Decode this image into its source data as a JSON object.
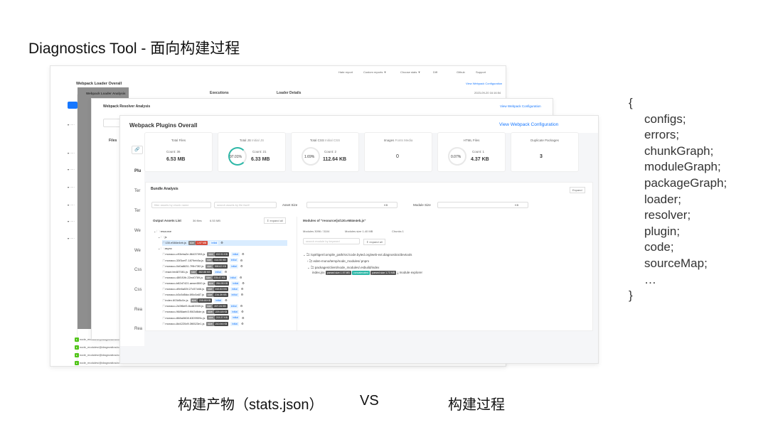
{
  "title": "Diagnostics Tool - 面向构建过程",
  "captions": {
    "left": "构建产物（stats.json）",
    "vs": "VS",
    "right": "构建过程"
  },
  "code_list": {
    "open": "{",
    "items": [
      "configs;",
      "errors;",
      "chunkGraph;",
      "moduleGraph;",
      "packageGraph;",
      "loader;",
      "resolver;",
      "plugin;",
      "code;",
      "sourceMap;",
      "…"
    ],
    "close": "}"
  },
  "top_nav": [
    "Hate report",
    "Custom reports ▼",
    "Choose stats ▼",
    "Diff",
    "Github",
    "Support"
  ],
  "loader_window": {
    "title": "Webpack Loader Overall",
    "link": "View Webpack Configuration",
    "sub_title": "Webpack Loader Analysis",
    "col1": "Executions",
    "col2": "Loader Details",
    "time": "2023-09-20 16:16:54"
  },
  "resolver_window": {
    "title": "Webpack Resolver Analysis",
    "link": "View Webpack Configuration",
    "files": "Files"
  },
  "plugins_window": {
    "title": "Webpack Plugins Overall",
    "link": "View Webpack Configuration",
    "side_labels": [
      "Plu",
      "Ter",
      "Ter",
      "We",
      "We",
      "Css",
      "Css",
      "Rea",
      "Rea"
    ],
    "cards": [
      {
        "title": "Total Files",
        "count": "Count: 36",
        "value": "6.53 MB"
      },
      {
        "title": "Total JS",
        "tabs": "Initial JS",
        "count": "Count: 21",
        "percent": "97.01%",
        "value": "6.33 MB",
        "ratio": 0.9701
      },
      {
        "title": "Total CSS",
        "tabs": "Initial CSS",
        "count": "Count: 2",
        "percent": "1.69%",
        "value": "112.64 KB",
        "ratio": 0.0169
      },
      {
        "title": "Images",
        "tabs": "Fonts  Media",
        "value": "0"
      },
      {
        "title": "HTML Files",
        "count": "Count: 1",
        "percent": "0.07%",
        "value": "4.37 KB",
        "ratio": 0.0007
      },
      {
        "title": "Duplicate Packages",
        "value": "3"
      }
    ],
    "bundle": {
      "title": "Bundle Analysis",
      "expand": "Expand",
      "search1": "filter assets by chunk name",
      "search2": "search assets by file itself",
      "asset_size": "Asset Size",
      "module_size": "Module Size",
      "unit": "KB",
      "assets_title": "Output Assets List",
      "assets_count": "36 files",
      "assets_size": "6.53 MB",
      "expand_all": "expand all",
      "tree": [
        {
          "name": "resource",
          "indent": 0
        },
        {
          "name": "js",
          "indent": 1
        },
        {
          "name": "130.e584e4eb.js",
          "indent": 2,
          "size": "1.97 MB",
          "selected": true
        },
        {
          "name": "async",
          "indent": 1
        },
        {
          "name": "monaco-c93eba2e.86437093.js",
          "indent": 2,
          "size": "432.91 KB"
        },
        {
          "name": "monaco-33f3cef7.1879eb0a.js",
          "indent": 2,
          "size": "414.00 KB"
        },
        {
          "name": "monaco-0d0a8631.7f9b73f2.js",
          "indent": 2,
          "size": "398.62 KB"
        },
        {
          "name": "react.bb487081.js",
          "indent": 2,
          "size": "382.88 KB"
        },
        {
          "name": "monaco-48f1f1fb.22ed0789.js",
          "indent": 2,
          "size": "378.47 KB"
        },
        {
          "name": "monaco-b82d7421.aeae4500.js",
          "indent": 2,
          "size": "284.95 KB"
        },
        {
          "name": "monaco-d9e6a53f.27c57d46.js",
          "indent": 2,
          "size": "243.53 KB"
        },
        {
          "name": "monaco-b3c5d5da.6f0c0a87.js",
          "indent": 2,
          "size": "234.39 KB"
        },
        {
          "name": "index.603d5c0e.js",
          "indent": 2,
          "size": "208.68 KB"
        },
        {
          "name": "monaco-2d3f6ef3.8cd83909.js",
          "indent": 2,
          "size": "207.24 KB"
        },
        {
          "name": "monaco-9686aeb3.f063d6de.js",
          "indent": 2,
          "size": "229.18 KB"
        },
        {
          "name": "monaco-868a0608.6309909c.js",
          "indent": 2,
          "size": "215.37 KB"
        },
        {
          "name": "monaco-8d4220d9.3f6523e1.js",
          "indent": 2,
          "size": "210.94 KB"
        }
      ],
      "modules_title": "Modules of \"resource/js/130.e584e4eb.js\"",
      "module_stats": [
        "Modules 3096 / 3104",
        "Modules size 1.40 MB",
        "Chunks 1"
      ],
      "module_search": "search module by keyword",
      "module_tree": [
        "/opt/tiger/compile_path/src/code.byted.org/web-ext.diagnostics/devtools",
        "eden-mono/temp/node_modules/.pnpm",
        "packages/client/node_modules/.esbuild/index"
      ],
      "module_file": "index.jsx",
      "module_tags": [
        "parsed size 1.97 MB",
        "concatenated",
        "parsed size 1.73 MB"
      ],
      "module_explorer": "module explorer"
    }
  },
  "bottom_rows": [
    "node_modules/@diagnostics/co",
    "node_modules/@diagnostics/co",
    "node_modules/@diagnostics/co",
    "node_modules/@diagnostics/co",
    "node_modules/@diagnostics/co"
  ],
  "colors": {
    "accent": "#1677ff",
    "ring": "#2db7a7",
    "red": "#d54b3c",
    "size_tag": "#555555",
    "selected": "#d9ecff"
  }
}
